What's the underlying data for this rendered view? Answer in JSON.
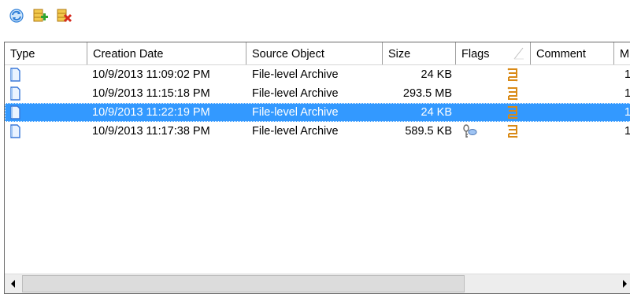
{
  "toolbar": {
    "buttons": [
      {
        "name": "refresh",
        "icon": "refresh-icon"
      },
      {
        "name": "add",
        "icon": "database-add-icon"
      },
      {
        "name": "delete",
        "icon": "database-delete-icon"
      }
    ]
  },
  "table": {
    "columns": [
      "Type",
      "Creation Date",
      "Source Object",
      "Size",
      "Flags",
      "Comment",
      "M"
    ],
    "rows": [
      {
        "creation_date": "10/9/2013 11:09:02 PM",
        "source_object": "File-level Archive",
        "size": "24 KB",
        "flags": [
          "archive-flag-icon"
        ],
        "comment": "",
        "m": "1",
        "selected": false
      },
      {
        "creation_date": "10/9/2013 11:15:18 PM",
        "source_object": "File-level Archive",
        "size": "293.5 MB",
        "flags": [
          "archive-flag-icon"
        ],
        "comment": "",
        "m": "1",
        "selected": false
      },
      {
        "creation_date": "10/9/2013 11:22:19 PM",
        "source_object": "File-level Archive",
        "size": "24 KB",
        "flags": [
          "archive-flag-icon"
        ],
        "comment": "",
        "m": "1",
        "selected": true
      },
      {
        "creation_date": "10/9/2013 11:17:38 PM",
        "source_object": "File-level Archive",
        "size": "589.5 KB",
        "flags": [
          "key-icon",
          "archive-flag-icon"
        ],
        "comment": "",
        "m": "1",
        "selected": false
      }
    ]
  },
  "colors": {
    "selection": "#3399ff",
    "archive_flag": "#d98a17",
    "doc_icon": "#3a78d8"
  }
}
